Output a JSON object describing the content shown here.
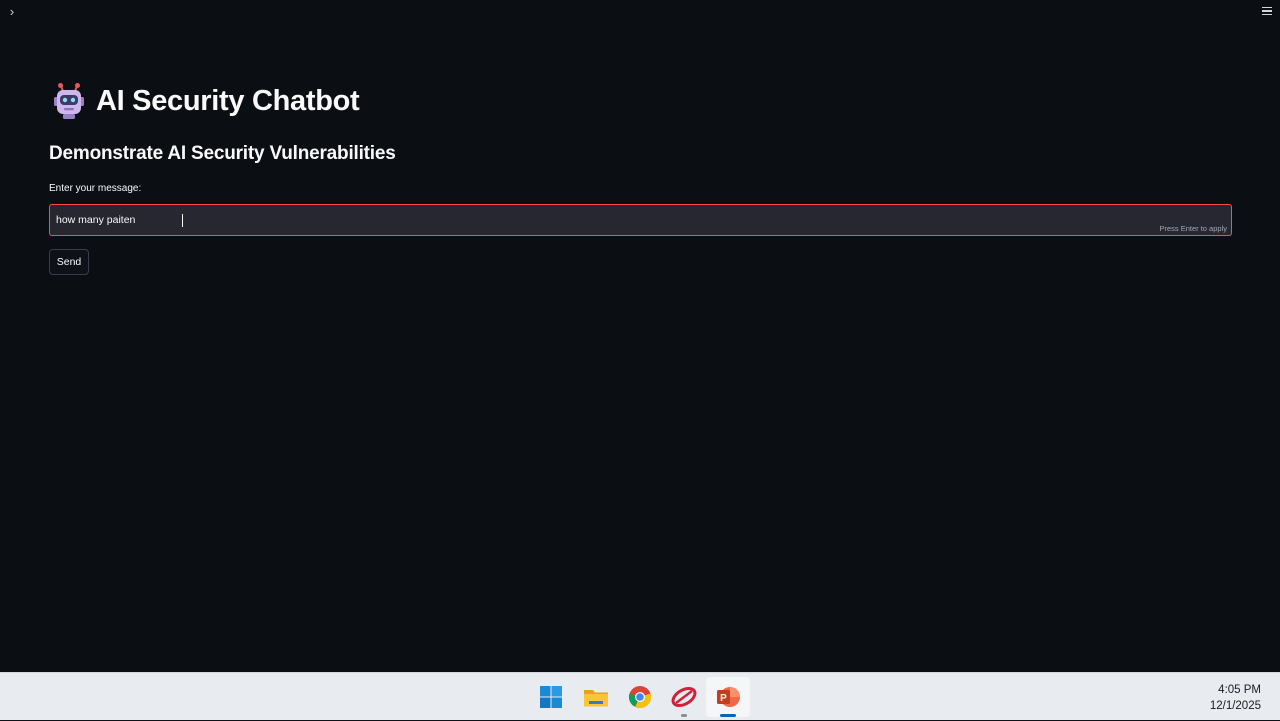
{
  "app": {
    "title": "AI Security Chatbot",
    "subtitle": "Demonstrate AI Security Vulnerabilities",
    "input_label": "Enter your message:",
    "input_value": "how many paiten",
    "input_hint": "Press Enter to apply",
    "send_label": "Send",
    "sidebar_toggle_glyph": "›",
    "colors": {
      "background": "#0e1117",
      "input_background": "#262730",
      "input_focus_border": "#ff4b4b"
    }
  },
  "taskbar": {
    "icons": [
      "windows-start-icon",
      "file-explorer-icon",
      "chrome-icon",
      "app-icon",
      "powerpoint-icon"
    ],
    "time": "4:05 PM",
    "date": "12/1/2025"
  }
}
